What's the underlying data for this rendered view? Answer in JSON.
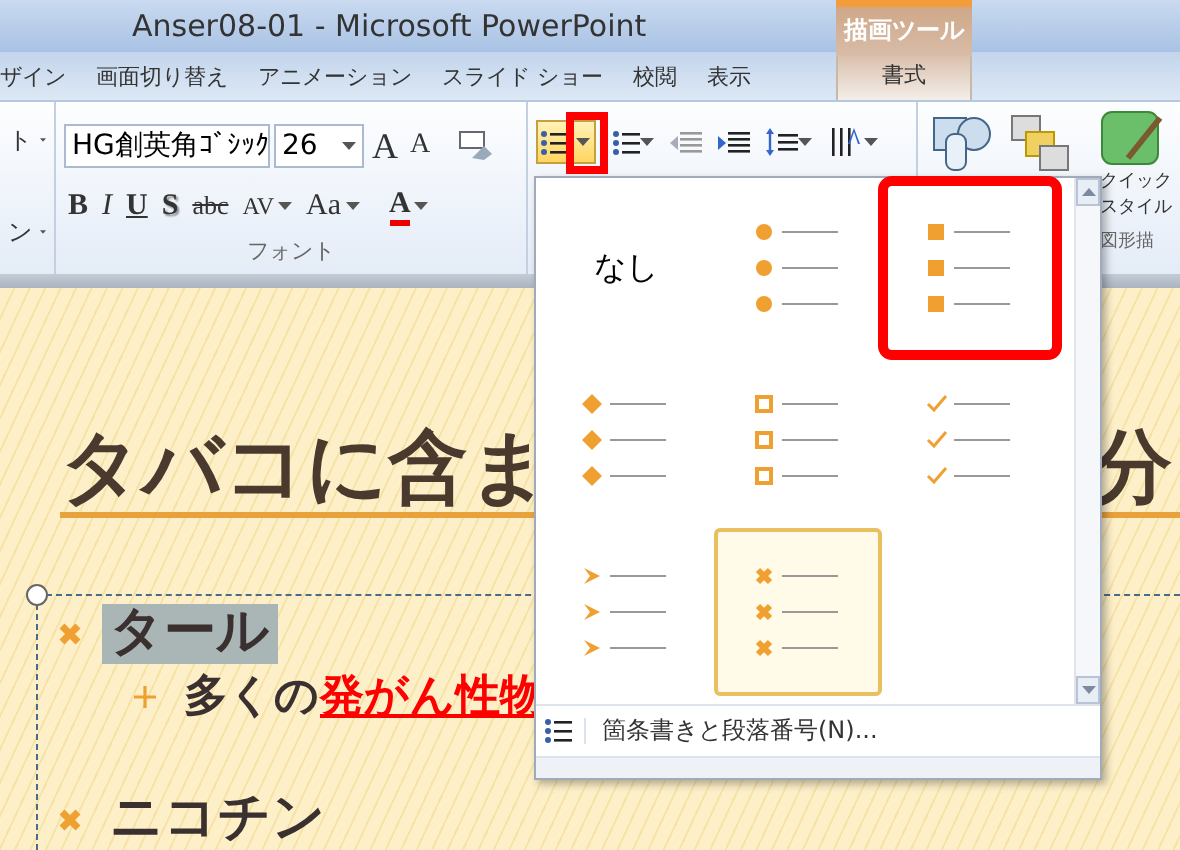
{
  "window": {
    "title": "Anser08-01  -  Microsoft PowerPoint",
    "context_tab": "描画ツール"
  },
  "tabs": [
    {
      "label": "ザイン",
      "selected": false
    },
    {
      "label": "画面切り替え",
      "selected": false
    },
    {
      "label": "アニメーション",
      "selected": false
    },
    {
      "label": "スライド ショー",
      "selected": false
    },
    {
      "label": "校閲",
      "selected": false
    },
    {
      "label": "表示",
      "selected": false
    },
    {
      "label": "書式",
      "selected": true
    }
  ],
  "ribbon": {
    "left_cut": [
      "ト",
      "ン"
    ],
    "font_group": {
      "font_name": "HG創英角ｺﾞｼｯｸ",
      "font_size": "26",
      "label": "フォント",
      "size_buttons": [
        {
          "kind": "grow",
          "label": "A"
        },
        {
          "kind": "shrink",
          "label": "A"
        }
      ],
      "format_buttons": [
        {
          "kind": "bold",
          "label": "B"
        },
        {
          "kind": "italic",
          "label": "I"
        },
        {
          "kind": "underline",
          "label": "U"
        },
        {
          "kind": "shadow",
          "label": "S"
        },
        {
          "kind": "strike",
          "label": "abc"
        },
        {
          "kind": "spacing",
          "label": "AV"
        },
        {
          "kind": "case",
          "label": "Aa"
        },
        {
          "kind": "color",
          "label": "A"
        }
      ]
    },
    "bullets_button": {
      "selected": true,
      "annotated": true
    },
    "drawing_group": {
      "quick_style": [
        "クイック",
        "スタイル"
      ],
      "label": "図形描"
    }
  },
  "bullet_gallery": {
    "items": [
      {
        "kind": "none",
        "label": "なし",
        "selected": false,
        "annotated": false
      },
      {
        "kind": "circle",
        "selected": false,
        "annotated": false
      },
      {
        "kind": "square",
        "selected": false,
        "annotated": true
      },
      {
        "kind": "diamond",
        "selected": false,
        "annotated": false
      },
      {
        "kind": "hollow-square",
        "selected": false,
        "annotated": false
      },
      {
        "kind": "check",
        "selected": false,
        "annotated": false
      },
      {
        "kind": "arrow",
        "selected": false,
        "annotated": false
      },
      {
        "kind": "cross",
        "selected": true,
        "annotated": false
      }
    ],
    "footer": "箇条書きと段落番号(N)..."
  },
  "slide": {
    "title_left": "タバコに含ま",
    "title_right": "分",
    "bullets": [
      {
        "text": "タール",
        "highlighted": true,
        "children": [
          {
            "text": "多くの",
            "emphasis": "発がん性物"
          }
        ]
      },
      {
        "text": "ニコチン",
        "highlighted": false
      }
    ]
  }
}
